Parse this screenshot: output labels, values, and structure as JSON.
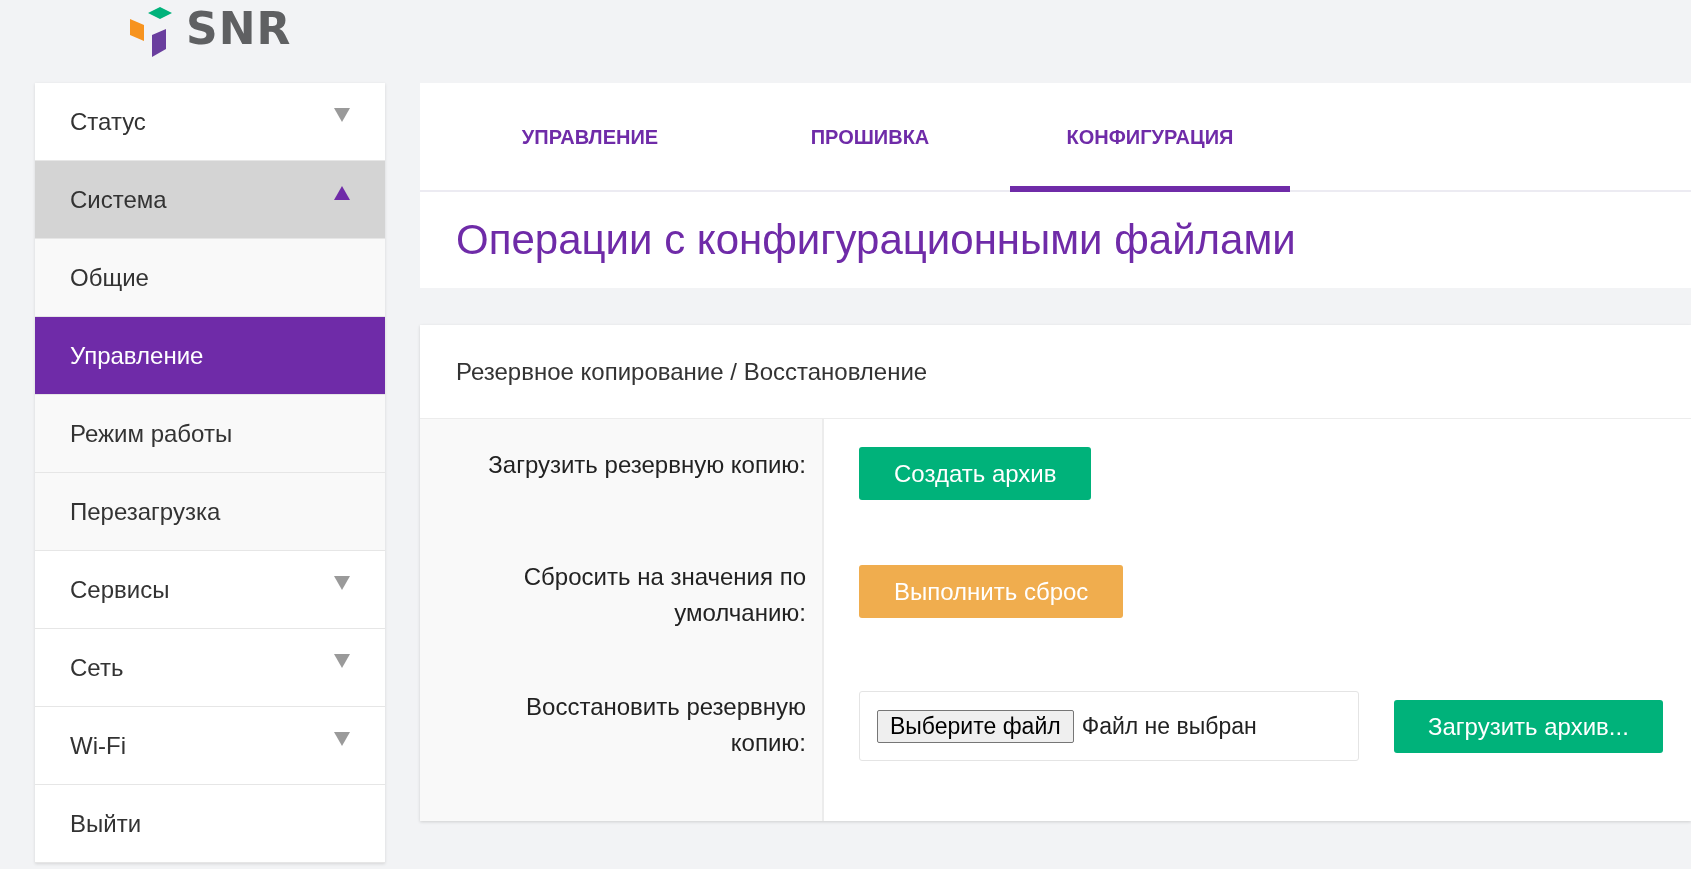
{
  "logo": {
    "text": "SNR"
  },
  "sidebar": {
    "items": [
      {
        "label": "Статус",
        "kind": "group",
        "expanded": false,
        "selected": false
      },
      {
        "label": "Система",
        "kind": "group",
        "expanded": true,
        "selected": false,
        "children": [
          {
            "label": "Общие",
            "selected": false
          },
          {
            "label": "Управление",
            "selected": true
          },
          {
            "label": "Режим работы",
            "selected": false
          },
          {
            "label": "Перезагрузка",
            "selected": false
          }
        ]
      },
      {
        "label": "Сервисы",
        "kind": "group",
        "expanded": false,
        "selected": false
      },
      {
        "label": "Сеть",
        "kind": "group",
        "expanded": false,
        "selected": false
      },
      {
        "label": "Wi-Fi",
        "kind": "group",
        "expanded": false,
        "selected": false
      },
      {
        "label": "Выйти",
        "kind": "link",
        "selected": false
      }
    ]
  },
  "tabs": [
    {
      "label": "УПРАВЛЕНИЕ",
      "selected": false
    },
    {
      "label": "ПРОШИВКА",
      "selected": false
    },
    {
      "label": "КОНФИГУРАЦИЯ",
      "selected": true
    }
  ],
  "page_title": "Операции с конфигурационными файлами",
  "section": {
    "title": "Резервное копирование / Восстановление",
    "rows": [
      {
        "label": "Загрузить резервную копию:",
        "kind": "button",
        "button": {
          "label": "Создать архив",
          "color": "#00b27a"
        }
      },
      {
        "label": "Сбросить на значения по умолчанию:",
        "kind": "button",
        "button": {
          "label": "Выполнить сброс",
          "color": "#f0ad4e"
        }
      },
      {
        "label": "Восстановить резервную копию:",
        "kind": "file",
        "file_button": "Выберите файл",
        "file_status": "Файл не выбран",
        "button": {
          "label": "Загрузить архив...",
          "color": "#00b27a"
        }
      }
    ]
  }
}
